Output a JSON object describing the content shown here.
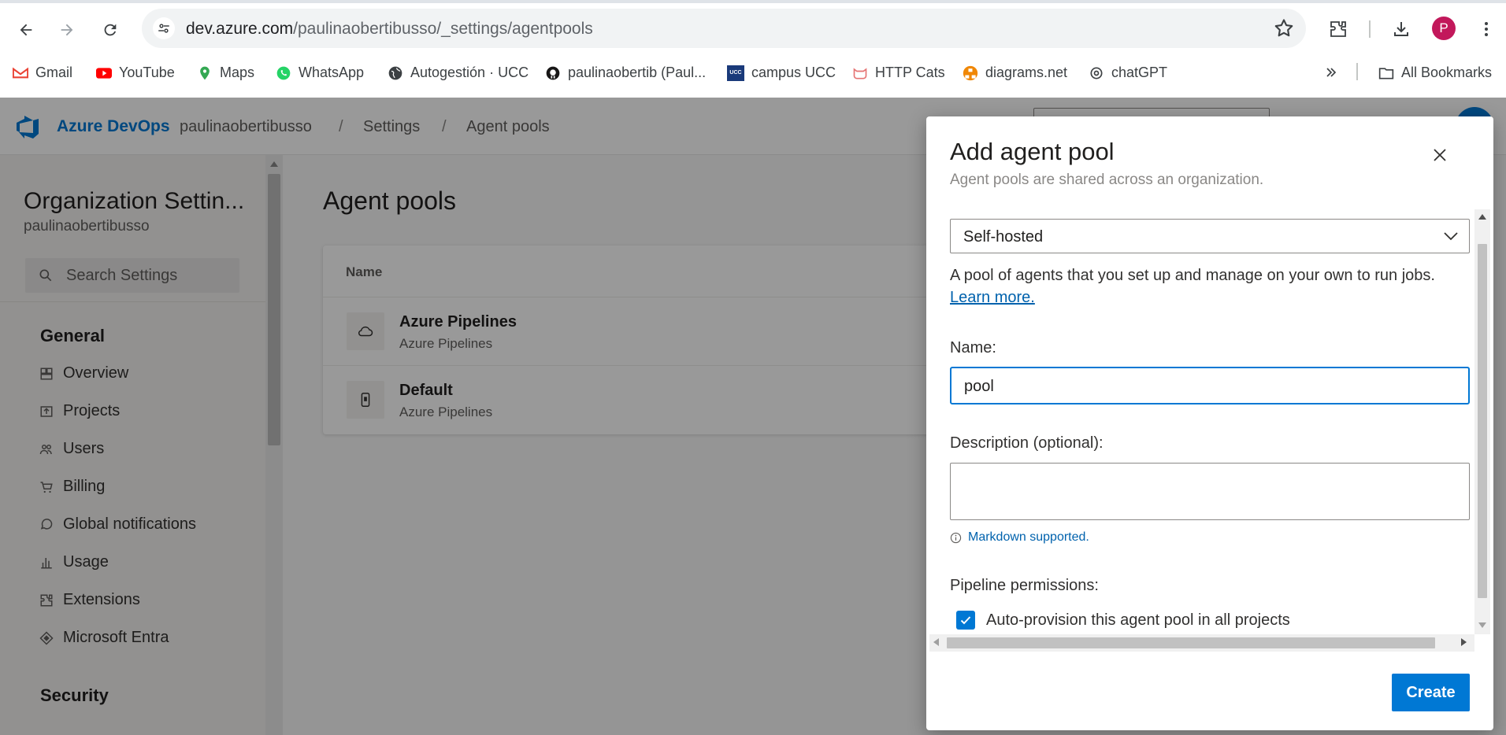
{
  "browser": {
    "url_host": "dev.azure.com",
    "url_path": "/paulinaobertibusso/_settings/agentpools",
    "profile_initial": "P",
    "bookmarks": [
      {
        "label": "Gmail",
        "icon": "gmail-icon",
        "color": "#ea4335"
      },
      {
        "label": "YouTube",
        "icon": "youtube-icon",
        "color": "#ff0000"
      },
      {
        "label": "Maps",
        "icon": "maps-icon",
        "color": "#34a853"
      },
      {
        "label": "WhatsApp",
        "icon": "whatsapp-icon",
        "color": "#25d366"
      },
      {
        "label": "Autogestión · UCC",
        "icon": "globe-icon",
        "color": "#3c4043"
      },
      {
        "label": "paulinaobertib (Paul...",
        "icon": "github-icon",
        "color": "#181717"
      },
      {
        "label": "campus UCC",
        "icon": "ucc-icon",
        "color": "#1a3a7a"
      },
      {
        "label": "HTTP Cats",
        "icon": "cats-icon",
        "color": "#e57373"
      },
      {
        "label": "diagrams.net",
        "icon": "diagrams-icon",
        "color": "#f08705"
      },
      {
        "label": "chatGPT",
        "icon": "openai-icon",
        "color": "#3c4043"
      }
    ],
    "all_bookmarks": "All Bookmarks"
  },
  "header": {
    "brand": "Azure DevOps",
    "org": "paulinaobertibusso",
    "sep": "/",
    "crumb_settings": "Settings",
    "crumb_page": "Agent pools"
  },
  "sidebar": {
    "title": "Organization Settin...",
    "org": "paulinaobertibusso",
    "search_placeholder": "Search Settings",
    "section_general": "General",
    "items": [
      {
        "label": "Overview",
        "icon": "overview-icon"
      },
      {
        "label": "Projects",
        "icon": "projects-icon"
      },
      {
        "label": "Users",
        "icon": "users-icon"
      },
      {
        "label": "Billing",
        "icon": "billing-icon"
      },
      {
        "label": "Global notifications",
        "icon": "notifications-icon"
      },
      {
        "label": "Usage",
        "icon": "usage-icon"
      },
      {
        "label": "Extensions",
        "icon": "extensions-icon"
      },
      {
        "label": "Microsoft Entra",
        "icon": "entra-icon"
      }
    ],
    "section_security": "Security"
  },
  "main": {
    "title": "Agent pools",
    "col_name": "Name",
    "pools": [
      {
        "name": "Azure Pipelines",
        "sub": "Azure Pipelines",
        "icon": "cloud-icon"
      },
      {
        "name": "Default",
        "sub": "Azure Pipelines",
        "icon": "device-icon"
      }
    ]
  },
  "dialog": {
    "title": "Add agent pool",
    "subtitle": "Agent pools are shared across an organization.",
    "pool_type": "Self-hosted",
    "type_desc": "A pool of agents that you set up and manage on your own to run jobs.",
    "learn_more": "Learn more.",
    "name_label": "Name:",
    "name_value": "pool",
    "desc_label": "Description (optional):",
    "desc_value": "",
    "markdown_note": "Markdown supported.",
    "permissions_label": "Pipeline permissions:",
    "auto_provision": "Auto-provision this agent pool in all projects",
    "auto_provision_checked": true,
    "create": "Create"
  },
  "colors": {
    "accent": "#0078d4",
    "link": "#0062ad"
  }
}
